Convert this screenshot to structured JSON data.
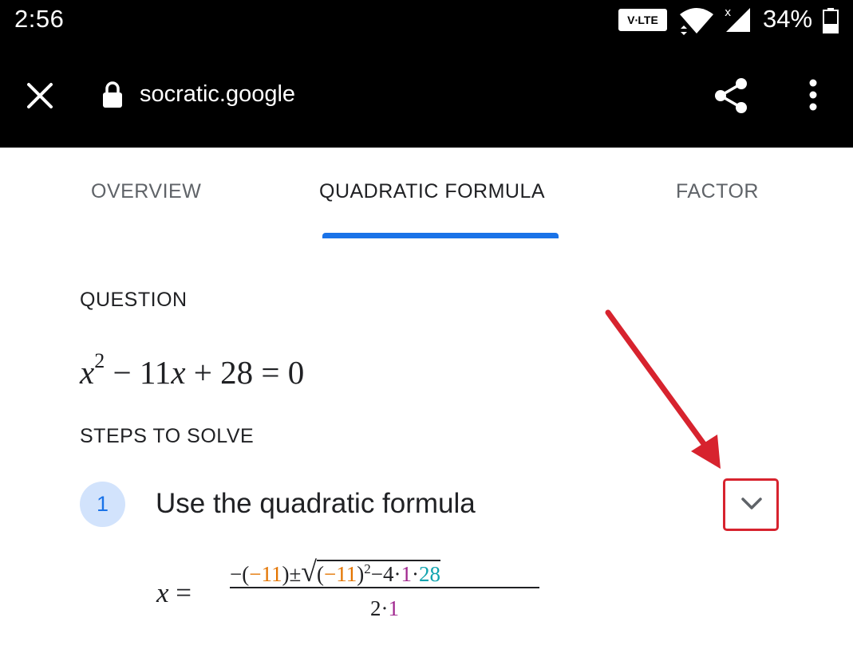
{
  "status_bar": {
    "time": "2:56",
    "volte": "V∙LTE",
    "battery": "34%"
  },
  "browser": {
    "url": "socratic.google"
  },
  "tabs": [
    {
      "label": "OVERVIEW",
      "active": false
    },
    {
      "label": "QUADRATIC FORMULA",
      "active": true
    },
    {
      "label": "FACTOR",
      "active": false
    }
  ],
  "question": {
    "label": "QUESTION",
    "equation": {
      "x": "x",
      "exp": "2",
      "rest": " − 11",
      "x2": "x",
      "tail": " + 28 = 0"
    }
  },
  "steps": {
    "label": "STEPS TO SOLVE",
    "items": [
      {
        "number": "1",
        "title": "Use the quadratic formula"
      }
    ]
  },
  "formula": {
    "lhs_var": "x",
    "equals": " =",
    "neg_open": "−(",
    "b1": "−11",
    "close_pm": ")±",
    "sqrt": "√",
    "paren_open": "(",
    "b2": "−11",
    "paren_close": ")",
    "sq": "2",
    "minus4": "−4·",
    "a": "1",
    "dot": "·",
    "c": "28",
    "denom_2": "2·",
    "denom_a": "1"
  },
  "colors": {
    "accent": "#1a73e8",
    "highlight_red": "#d7232e",
    "b_term": "#e37400",
    "a_term": "#a0278f",
    "c_term": "#12a4af"
  },
  "icons": [
    "wifi-icon",
    "signal-icon",
    "battery-icon",
    "close-icon",
    "lock-icon",
    "share-icon",
    "more-vert-icon",
    "chevron-down-icon",
    "red-arrow-annotation"
  ]
}
